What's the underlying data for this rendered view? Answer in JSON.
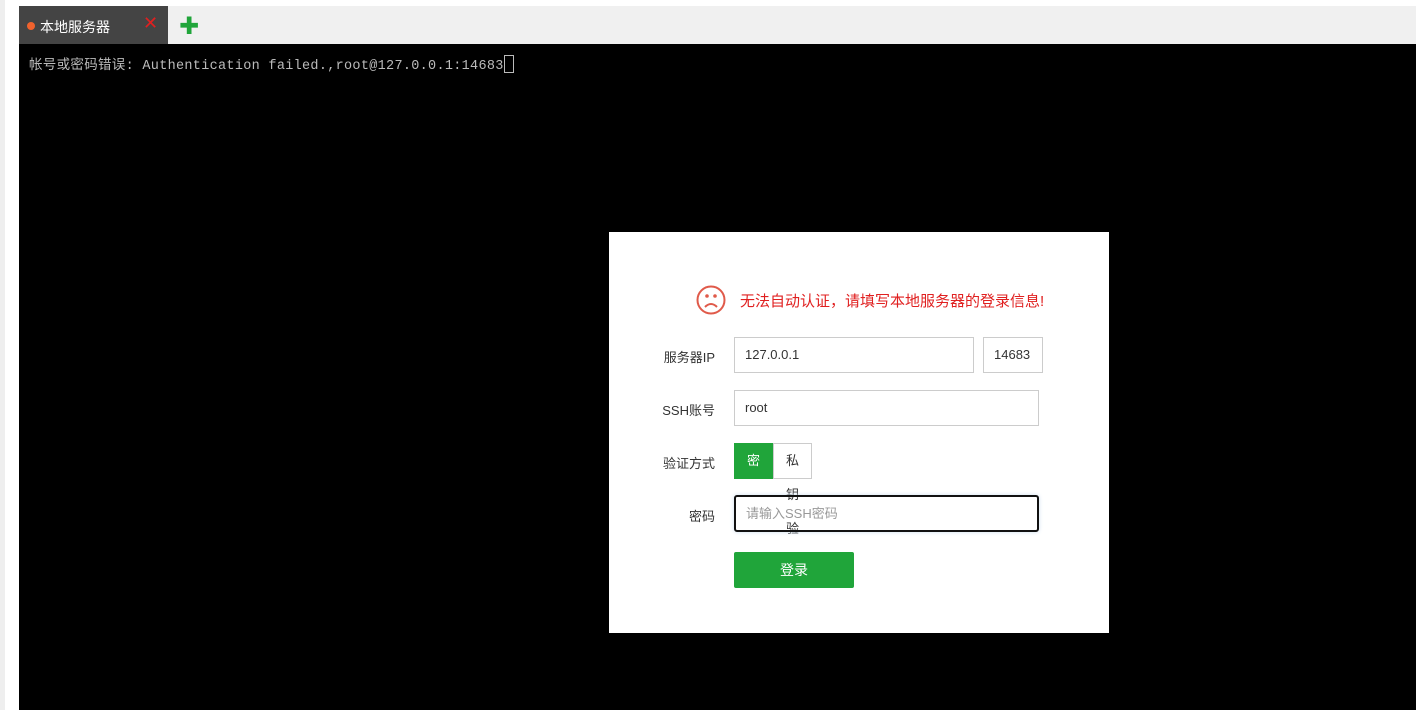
{
  "tabs": [
    {
      "label": "本地服务器",
      "status_color": "#f0622d"
    }
  ],
  "add_tab_icon": "plus-icon",
  "terminal": {
    "text": "帐号或密码错误: Authentication failed.,root@127.0.0.1:14683"
  },
  "dialog": {
    "error_icon": "sad-face-icon",
    "error_message": "无法自动认证，请填写本地服务器的登录信息!",
    "ip_label": "服务器IP",
    "ip_value": "127.0.0.1",
    "port_value": "14683",
    "user_label": "SSH账号",
    "user_value": "root",
    "auth_label": "验证方式",
    "auth_options": [
      "密码验证",
      "私钥验证"
    ],
    "auth_selected": "密码验证",
    "password_label": "密码",
    "password_placeholder": "请输入SSH密码",
    "password_value": "",
    "login_label": "登录"
  },
  "colors": {
    "accent": "#20a53a",
    "error": "#e02020"
  }
}
